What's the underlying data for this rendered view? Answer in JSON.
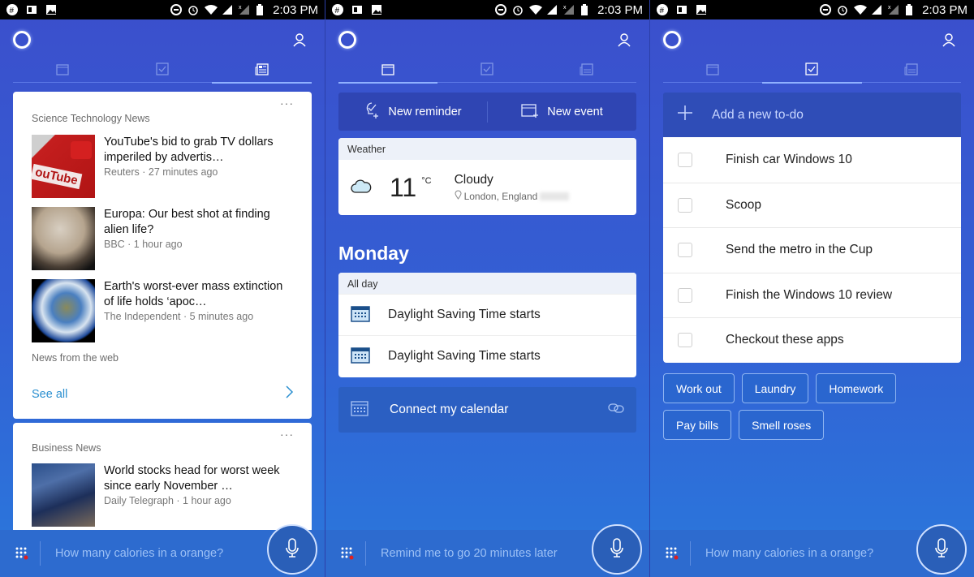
{
  "status_bar": {
    "time": "2:03 PM",
    "icons": [
      "slack-icon",
      "outlook-icon",
      "image-icon",
      "dnd-icon",
      "alarm-icon",
      "wifi-icon",
      "signal-icon",
      "no-signal-icon",
      "battery-icon"
    ]
  },
  "panels": [
    {
      "active_tab": "news",
      "cards": [
        {
          "header": "Science Technology News",
          "more": "···",
          "items": [
            {
              "title": "YouTube's bid to grab TV dollars imperiled by advertis…",
              "meta": "Reuters · 27 minutes ago"
            },
            {
              "title": "Europa: Our best shot at finding alien life?",
              "meta": "BBC · 1 hour ago"
            },
            {
              "title": "Earth's worst-ever mass extinction of life holds ‘apoc…",
              "meta": "The Independent · 5 minutes ago"
            }
          ],
          "footer": "News from the web",
          "see_all": "See all"
        },
        {
          "header": "Business News",
          "more": "···",
          "items": [
            {
              "title": "World stocks head for worst week since early November …",
              "meta": "Daily Telegraph · 1 hour ago"
            }
          ]
        }
      ],
      "prompt": "How many calories in a orange?"
    },
    {
      "active_tab": "calendar",
      "quick_actions": {
        "reminder": "New reminder",
        "event": "New event"
      },
      "weather": {
        "header": "Weather",
        "temp": "11",
        "unit": "°C",
        "condition": "Cloudy",
        "location": "London, England"
      },
      "day": "Monday",
      "events_header": "All day",
      "events": [
        "Daylight Saving Time starts",
        "Daylight Saving Time starts"
      ],
      "connect": "Connect my calendar",
      "prompt": "Remind me to go 20 minutes later"
    },
    {
      "active_tab": "todo",
      "add_todo": "Add a new to-do",
      "todos": [
        "Finish car Windows 10",
        "Scoop",
        "Send the metro in the Cup",
        "Finish the Windows 10 review",
        "Checkout these apps"
      ],
      "suggestions": [
        "Work out",
        "Laundry",
        "Homework",
        "Pay bills",
        "Smell roses"
      ],
      "prompt": "How many calories in a orange?"
    }
  ]
}
